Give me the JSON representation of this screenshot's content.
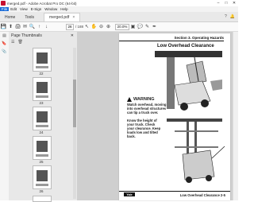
{
  "window": {
    "title": "merged.pdf - Adobe Acrobat Pro DC (64-bit)",
    "controls": [
      "–",
      "□",
      "✕"
    ]
  },
  "menu": [
    "File",
    "Edit",
    "View",
    "E-Sign",
    "Window",
    "Help"
  ],
  "tabs": {
    "home": "Home",
    "tools": "Tools",
    "document": "merged.pdf",
    "close": "×"
  },
  "tabbar_right": {
    "help": "?",
    "notifications": "🔔"
  },
  "toolbar": {
    "current_page": "26",
    "total_pages": "/ 188",
    "zoom": "20.0%"
  },
  "thumbpanel": {
    "title": "Page Thumbnails",
    "close": "✕",
    "thumb_labels": [
      "22",
      "23",
      "24",
      "25",
      "26",
      "27"
    ]
  },
  "page": {
    "section_header": "Section 3. Operating Hazards",
    "title": "Low Overhead Clearance",
    "warning_label": "WARNING",
    "warning_text": "Watch overhead, moving into overhead structures can tip a truck over.",
    "know_text": "Know the height of your truck. Check your clearance. Keep loads low and tilted back.",
    "footer_right": "Low Overhead Clearance   2-5",
    "footer_left": "Yale"
  }
}
